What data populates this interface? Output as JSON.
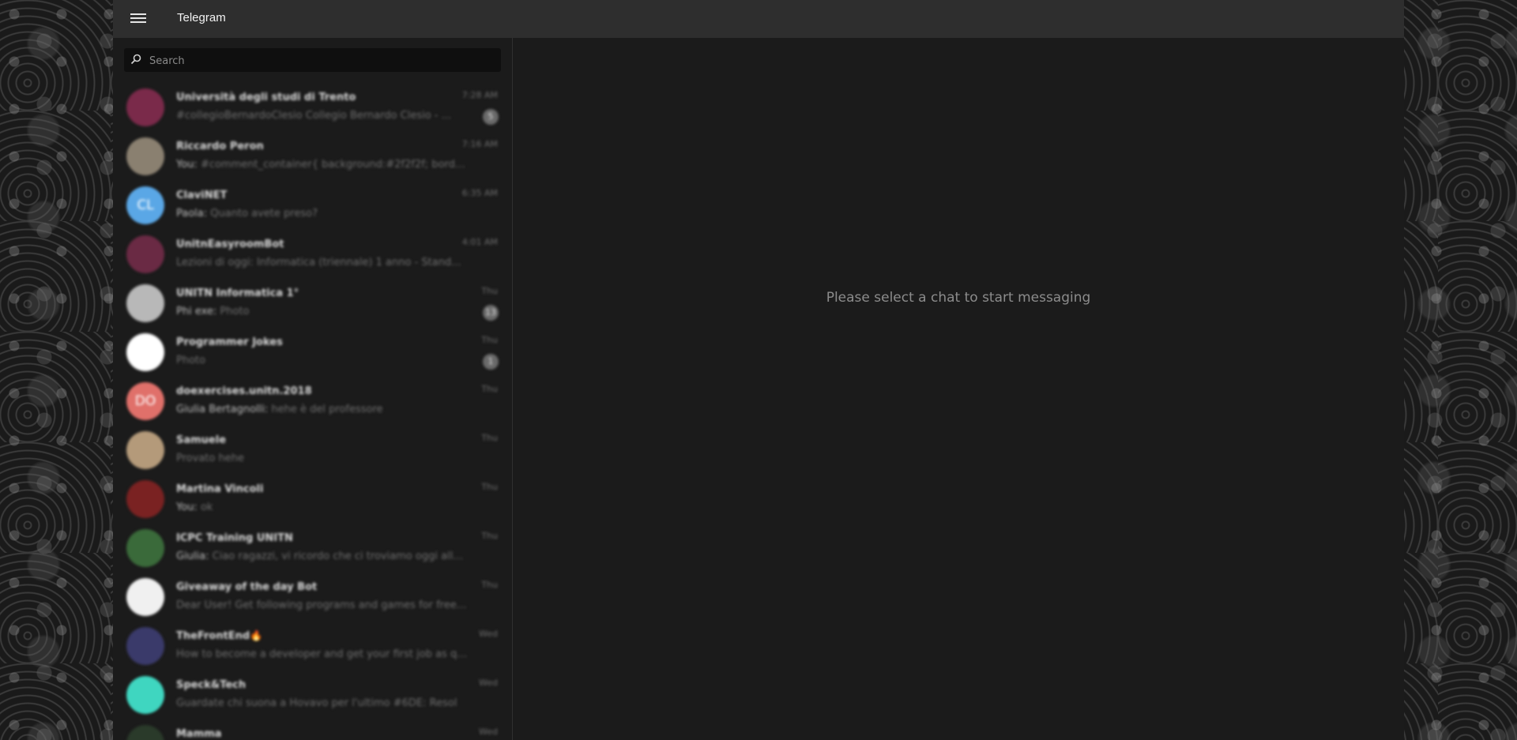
{
  "app": {
    "title": "Telegram"
  },
  "search": {
    "placeholder": "Search"
  },
  "chats": [
    {
      "name": "Università degli studi di Trento",
      "preview": "#collegioBernardoClesio Collegio Bernardo Clesio - ...",
      "sender": "",
      "time": "7:28 AM",
      "badge": "5",
      "avatar_color": "#7a2a4a",
      "avatar_text": ""
    },
    {
      "name": "Riccardo Peron",
      "preview": "#comment_container{ background:#2f2f2f; border: ...",
      "sender": "You:",
      "time": "7:16 AM",
      "badge": "",
      "avatar_color": "#8a8070",
      "avatar_text": ""
    },
    {
      "name": "ClaviNET",
      "preview": "Quanto avete preso?",
      "sender": "Paola:",
      "time": "6:35 AM",
      "badge": "",
      "avatar_color": "#5aa7e6",
      "avatar_text": "CL"
    },
    {
      "name": "UnitnEasyroomBot",
      "preview": "Lezioni di oggi: Informatica (triennale) 1 anno - Stand...",
      "sender": "",
      "time": "4:01 AM",
      "badge": "",
      "avatar_color": "#6a2a44",
      "avatar_text": ""
    },
    {
      "name": "UNITN Informatica 1°",
      "preview": "Photo",
      "sender": "Phi exe:",
      "time": "Thu",
      "badge": "13",
      "avatar_color": "#b8b8b8",
      "avatar_text": ""
    },
    {
      "name": "Programmer Jokes",
      "preview": "Photo",
      "sender": "",
      "time": "Thu",
      "badge": "1",
      "avatar_color": "#ffffff",
      "avatar_text": ""
    },
    {
      "name": "doexercises.unitn.2018",
      "preview": "hehe è del professore",
      "sender": "Giulia Bertagnolli:",
      "time": "Thu",
      "badge": "",
      "avatar_color": "#e0706a",
      "avatar_text": "DO"
    },
    {
      "name": "Samuele",
      "preview": "Provato hehe",
      "sender": "",
      "time": "Thu",
      "badge": "",
      "avatar_color": "#b49a7a",
      "avatar_text": ""
    },
    {
      "name": "Martina Vincoli",
      "preview": "ok",
      "sender": "You:",
      "time": "Thu",
      "badge": "",
      "avatar_color": "#7a2222",
      "avatar_text": ""
    },
    {
      "name": "ICPC Training UNITN",
      "preview": "Ciao ragazzi, vi ricordo che ci troviamo oggi alle 1...",
      "sender": "Giulia:",
      "time": "Thu",
      "badge": "",
      "avatar_color": "#3a6a3a",
      "avatar_text": ""
    },
    {
      "name": "Giveaway of the day Bot",
      "preview": "Dear User! Get following programs and games for free t...",
      "sender": "",
      "time": "Thu",
      "badge": "",
      "avatar_color": "#f0f0f0",
      "avatar_text": ""
    },
    {
      "name": "TheFrontEnd🔥",
      "preview": "How to become a developer and get your first job as qui...",
      "sender": "",
      "time": "Wed",
      "badge": "",
      "avatar_color": "#3a3a6a",
      "avatar_text": ""
    },
    {
      "name": "Speck&Tech",
      "preview": "Guardate chi suona a Hovavo per l'ultimo #6DE: Resol",
      "sender": "",
      "time": "Wed",
      "badge": "",
      "avatar_color": "#3fd6c0",
      "avatar_text": ""
    },
    {
      "name": "Mamma",
      "preview": "",
      "sender": "",
      "time": "Wed",
      "badge": "",
      "avatar_color": "#2a3a2a",
      "avatar_text": ""
    }
  ],
  "main": {
    "empty_text": "Please select a chat to start messaging"
  },
  "colors": {
    "header": "#2e2e2e",
    "panel": "#1b1b1b",
    "search_bg": "#0f0f0f"
  }
}
